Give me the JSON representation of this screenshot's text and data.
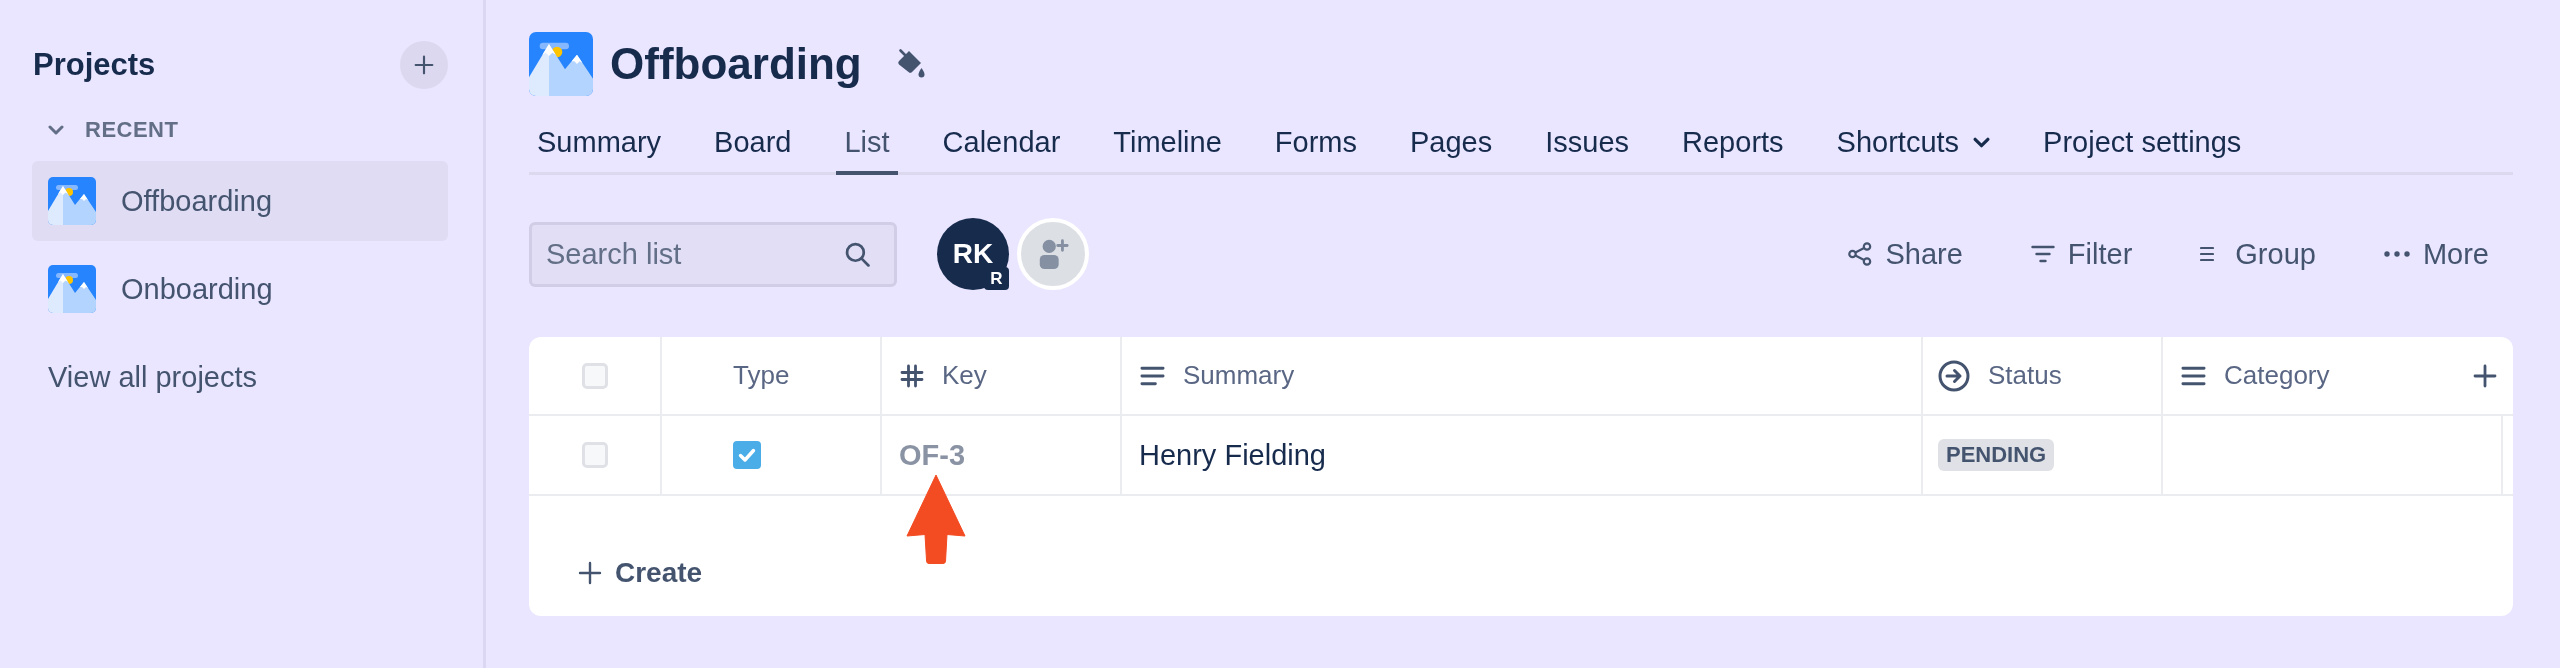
{
  "sidebar": {
    "title": "Projects",
    "section": {
      "label": "RECENT",
      "expanded": true
    },
    "projects": [
      {
        "name": "Offboarding",
        "selected": true
      },
      {
        "name": "Onboarding",
        "selected": false
      }
    ],
    "view_all": "View all projects"
  },
  "project": {
    "title": "Offboarding"
  },
  "tabs": [
    {
      "label": "Summary",
      "selected": false,
      "dropdown": false
    },
    {
      "label": "Board",
      "selected": false,
      "dropdown": false
    },
    {
      "label": "List",
      "selected": true,
      "dropdown": false
    },
    {
      "label": "Calendar",
      "selected": false,
      "dropdown": false
    },
    {
      "label": "Timeline",
      "selected": false,
      "dropdown": false
    },
    {
      "label": "Forms",
      "selected": false,
      "dropdown": false
    },
    {
      "label": "Pages",
      "selected": false,
      "dropdown": false
    },
    {
      "label": "Issues",
      "selected": false,
      "dropdown": false
    },
    {
      "label": "Reports",
      "selected": false,
      "dropdown": false
    },
    {
      "label": "Shortcuts",
      "selected": false,
      "dropdown": true
    },
    {
      "label": "Project settings",
      "selected": false,
      "dropdown": false
    }
  ],
  "toolbar": {
    "search": {
      "placeholder": "Search list"
    },
    "avatar": {
      "initials": "RK",
      "badge": "R"
    },
    "actions": [
      {
        "kind": "share",
        "label": "Share"
      },
      {
        "kind": "filter",
        "label": "Filter"
      },
      {
        "kind": "group",
        "label": "Group"
      },
      {
        "kind": "more",
        "label": "More"
      }
    ]
  },
  "table": {
    "select_all": {
      "checked": false
    },
    "columns": [
      {
        "kind": "type",
        "label": "Type"
      },
      {
        "kind": "key",
        "label": "Key"
      },
      {
        "kind": "text",
        "label": "Summary"
      },
      {
        "kind": "status",
        "label": "Status"
      },
      {
        "kind": "select",
        "label": "Category"
      }
    ],
    "rows": [
      {
        "selected": false,
        "key": "OF-3",
        "summary": "Henry Fielding",
        "status": "PENDING"
      }
    ],
    "create": "Create"
  }
}
